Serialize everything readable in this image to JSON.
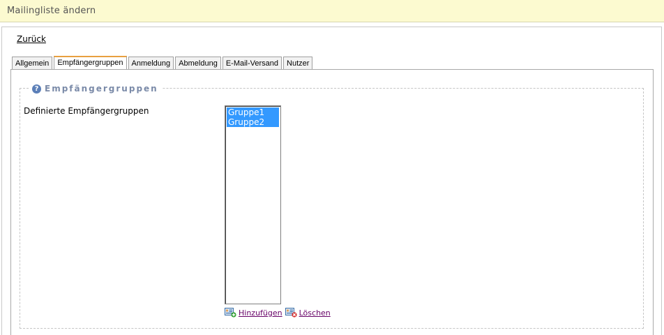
{
  "header": {
    "title": "Mailingliste ändern"
  },
  "navigation": {
    "back_label": "Zurück"
  },
  "tabs": [
    {
      "label": "Allgemein",
      "active": false
    },
    {
      "label": "Empfängergruppen",
      "active": true
    },
    {
      "label": "Anmeldung",
      "active": false
    },
    {
      "label": "Abmeldung",
      "active": false
    },
    {
      "label": "E-Mail-Versand",
      "active": false
    },
    {
      "label": "Nutzer",
      "active": false
    }
  ],
  "fieldset": {
    "legend": "Empfängergruppen",
    "legend_icon": "help-icon",
    "field_label": "Definierte Empfängergruppen",
    "groups": [
      "Gruppe1",
      "Gruppe2"
    ]
  },
  "actions": {
    "add_label": "Hinzufügen",
    "add_icon": "add-group-icon",
    "delete_label": "Löschen",
    "delete_icon": "delete-group-icon"
  },
  "colors": {
    "header_bg": "#fcfad0",
    "selection": "#3399ff",
    "active_tab_accent": "#e8a040",
    "link_visited": "#660066",
    "legend_text": "#7a8aa8"
  }
}
